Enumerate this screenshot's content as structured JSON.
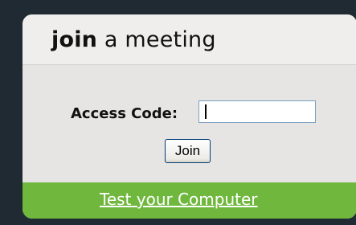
{
  "card": {
    "title_bold": "join",
    "title_rest": " a meeting"
  },
  "form": {
    "access_code_label": "Access Code:",
    "access_code_value": "",
    "join_label": "Join"
  },
  "footer": {
    "link_label": "Test your Computer"
  },
  "colors": {
    "background": "#1f2a33",
    "card": "#e7e5e3",
    "footer": "#6fb73d",
    "input_border": "#7b9ebd"
  }
}
